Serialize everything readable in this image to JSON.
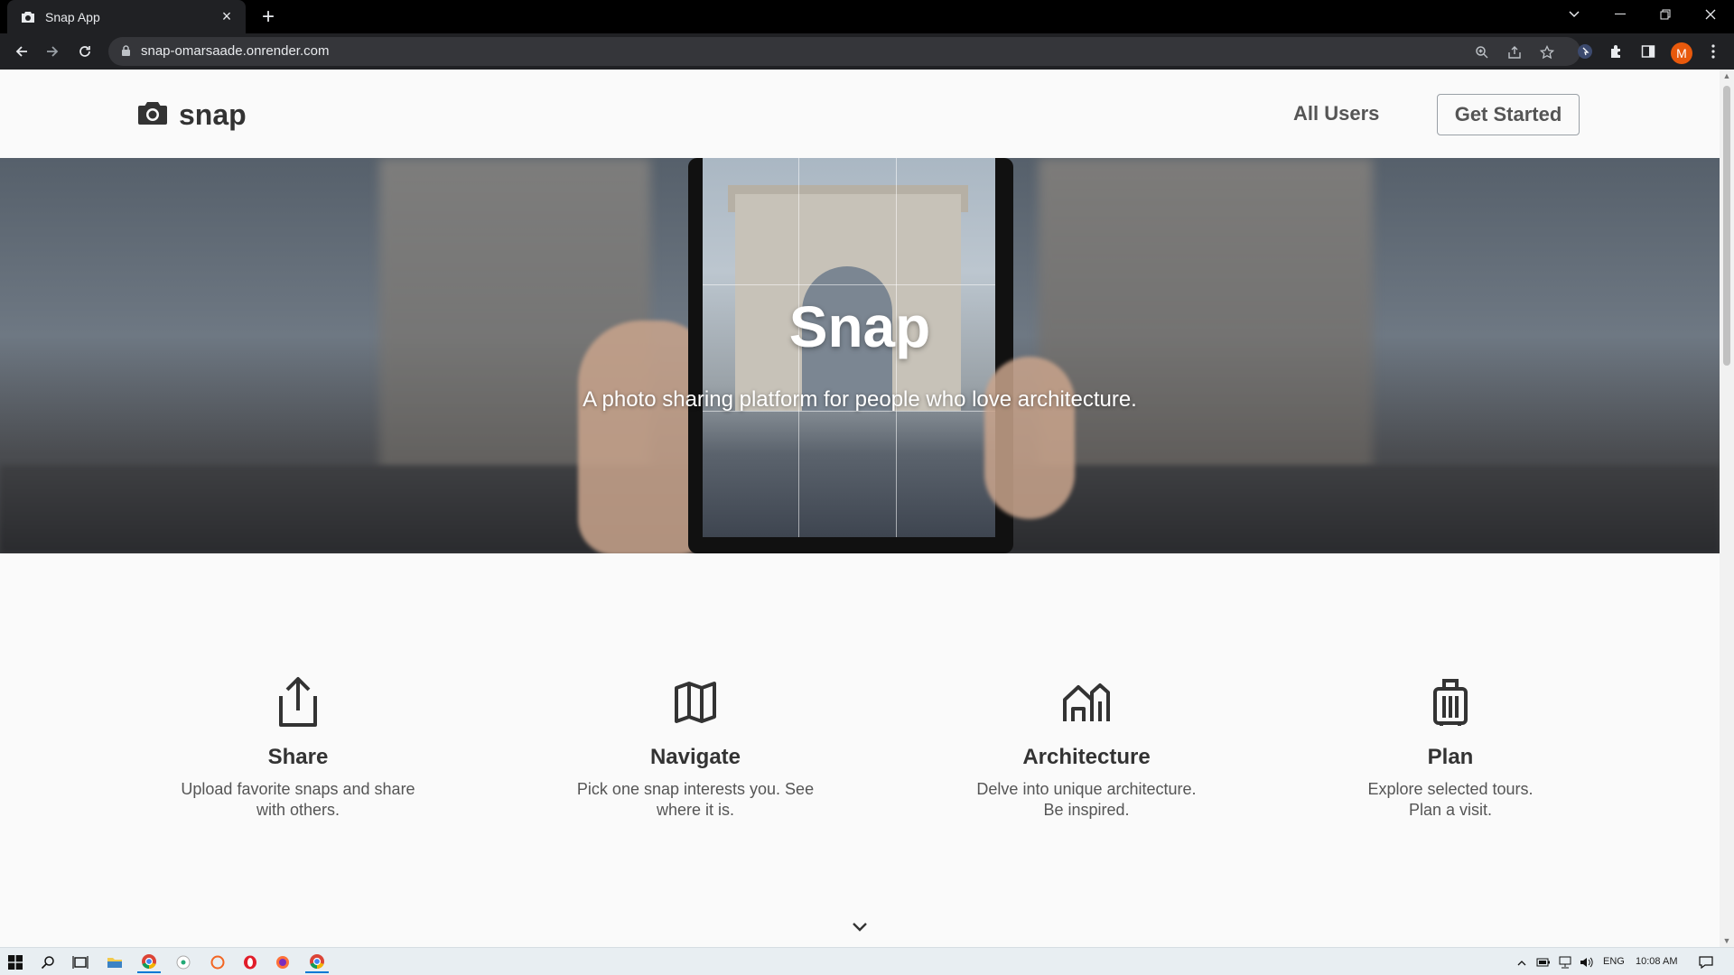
{
  "browser": {
    "tab_title": "Snap App",
    "url": "snap-omarsaade.onrender.com",
    "profile_initial": "M"
  },
  "site": {
    "logo_text": "snap",
    "nav": {
      "all_users": "All Users",
      "get_started": "Get Started"
    },
    "hero": {
      "title": "Snap",
      "subtitle": "A photo sharing platform for people who love architecture."
    },
    "features": [
      {
        "icon": "share-icon",
        "title": "Share",
        "line1": "Upload favorite snaps and share",
        "line2": "with others."
      },
      {
        "icon": "map-icon",
        "title": "Navigate",
        "line1": "Pick one snap interests you. See",
        "line2": "where it is."
      },
      {
        "icon": "buildings-icon",
        "title": "Architecture",
        "line1": "Delve into unique architecture.",
        "line2": "Be inspired."
      },
      {
        "icon": "suitcase-icon",
        "title": "Plan",
        "line1": "Explore selected tours.",
        "line2": "Plan a visit."
      }
    ]
  },
  "taskbar": {
    "language": "ENG",
    "time": "10:08 AM"
  },
  "colors": {
    "chrome_dark": "#202124",
    "page_bg": "#fafafa",
    "text_dark": "#333333",
    "avatar": "#e8590c"
  }
}
